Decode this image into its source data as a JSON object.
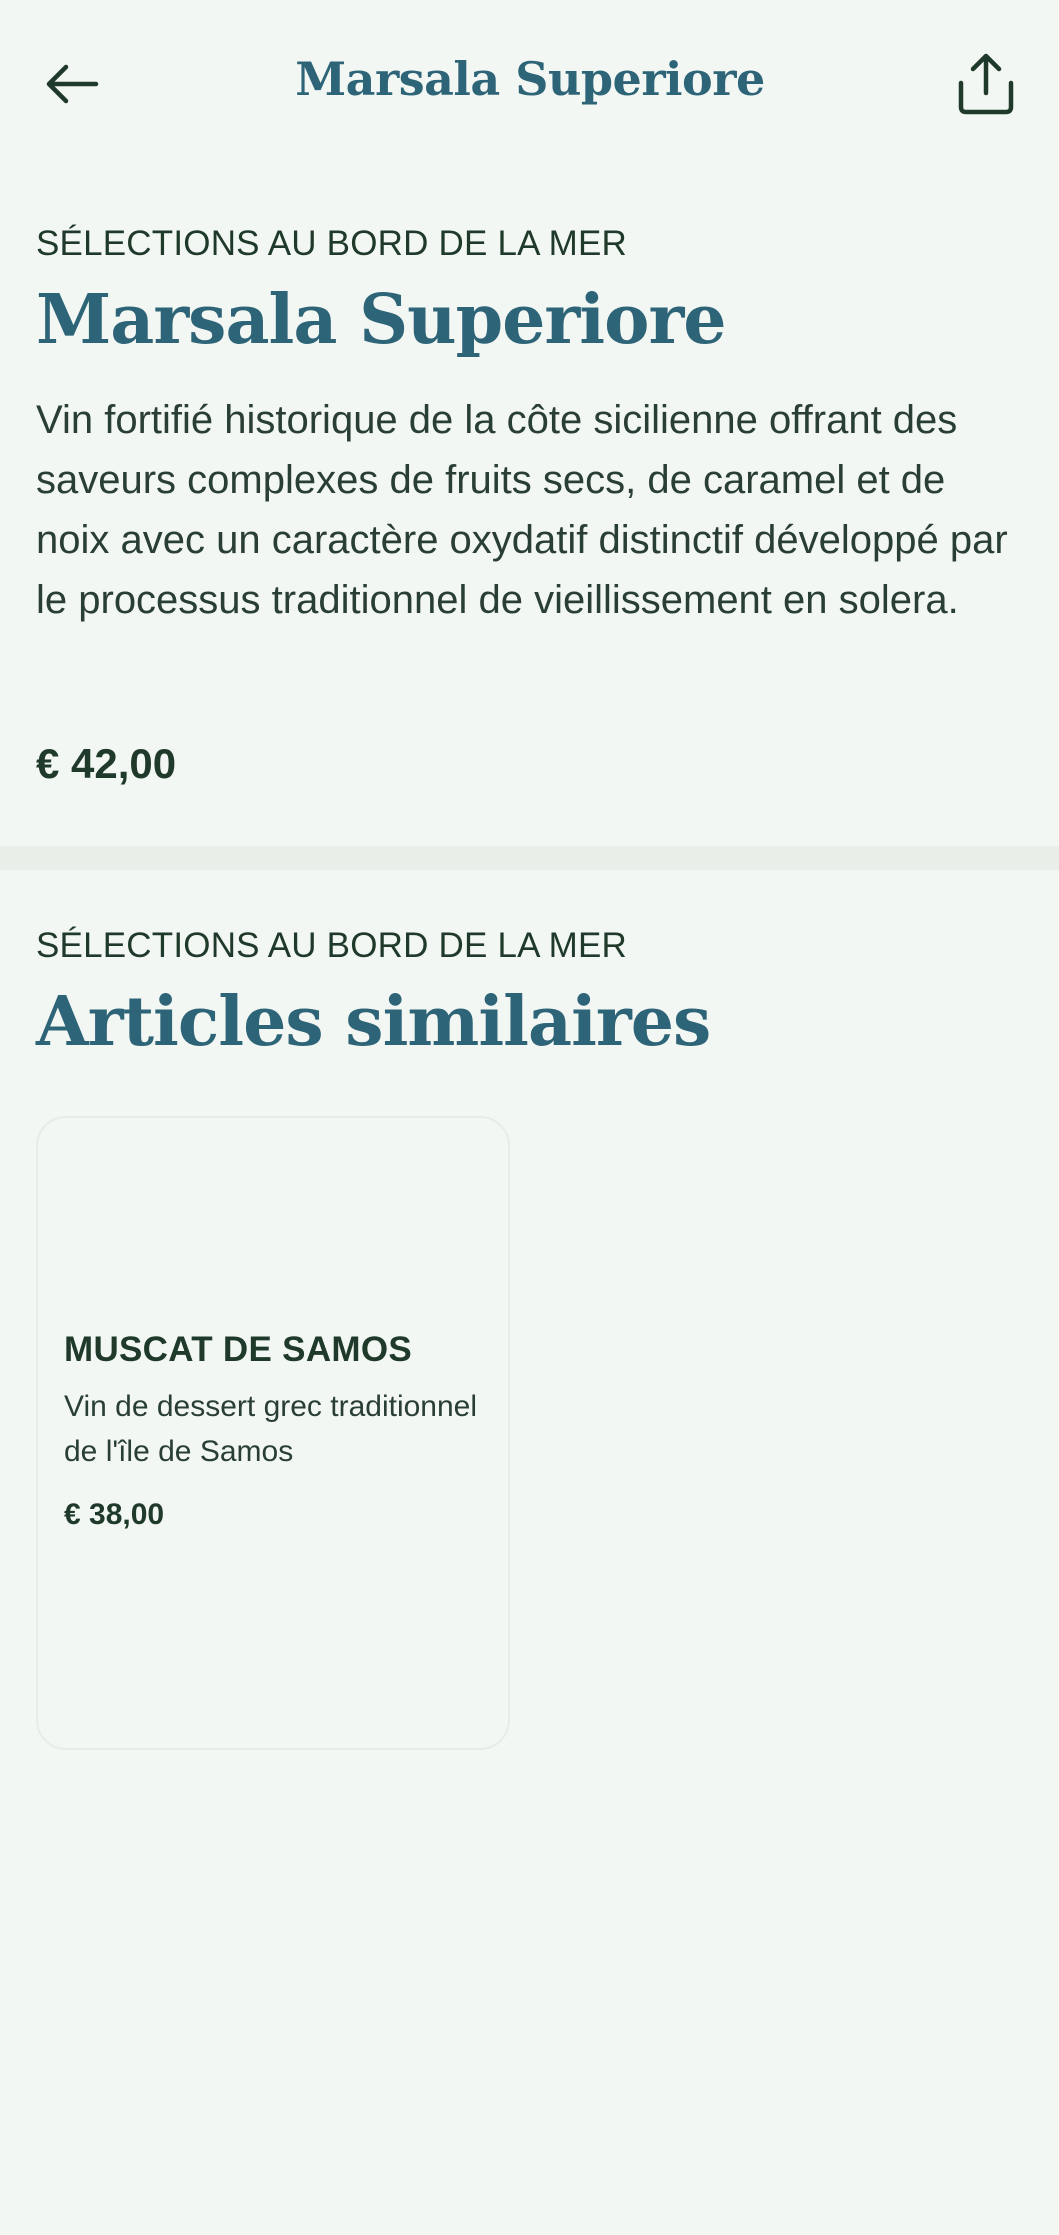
{
  "header": {
    "title": "Marsala Superiore",
    "back_icon": "arrow-left-icon",
    "share_icon": "share-icon"
  },
  "product": {
    "category": "SÉLECTIONS AU BORD DE LA MER",
    "name": "Marsala Superiore",
    "description": "Vin fortifié historique de la côte sicilienne offrant des saveurs complexes de fruits secs, de caramel et de noix avec un caractère oxydatif distinctif développé par le processus traditionnel de vieillissement en solera.",
    "price": "€ 42,00"
  },
  "similar": {
    "category": "SÉLECTIONS AU BORD DE LA MER",
    "title": "Articles similaires",
    "items": [
      {
        "name": "MUSCAT DE SAMOS",
        "description": "Vin de dessert grec traditionnel de l'île de Samos",
        "price": "€ 38,00"
      }
    ]
  },
  "colors": {
    "background": "#f3f7f3",
    "accent": "#2e6478",
    "text": "#1f3a2a",
    "divider": "#e8efe9"
  }
}
